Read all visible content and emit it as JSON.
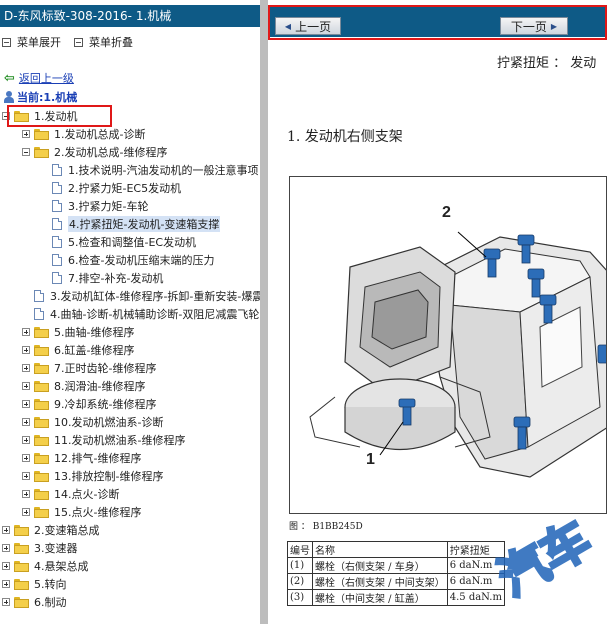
{
  "sidebar": {
    "title": "D-东风标致-308-2016- 1.机械",
    "menu_expand": "菜单展开",
    "menu_collapse": "菜单折叠",
    "back": "返回上一级",
    "current": "当前:1.机械",
    "tree": [
      {
        "label": "1.发动机",
        "level": 0,
        "type": "folder",
        "toggle": "minus"
      },
      {
        "label": "1.发动机总成-诊断",
        "level": 1,
        "type": "folder",
        "toggle": "plus"
      },
      {
        "label": "2.发动机总成-维修程序",
        "level": 1,
        "type": "folder",
        "toggle": "minus"
      },
      {
        "label": "1.技术说明-汽油发动机的一般注意事项",
        "level": 2,
        "type": "page"
      },
      {
        "label": "2.拧紧力矩-EC5发动机",
        "level": 2,
        "type": "page"
      },
      {
        "label": "3.拧紧力矩-车轮",
        "level": 2,
        "type": "page"
      },
      {
        "label": "4.拧紧扭矩-发动机-变速箱支撑",
        "level": 2,
        "type": "page",
        "selected": true
      },
      {
        "label": "5.检查和调整值-EC发动机",
        "level": 2,
        "type": "page"
      },
      {
        "label": "6.检查-发动机压缩末端的压力",
        "level": 2,
        "type": "page"
      },
      {
        "label": "7.排空-补充-发动机",
        "level": 2,
        "type": "page"
      },
      {
        "label": "3.发动机缸体-维修程序-拆卸-重新安装-爆震",
        "level": 1,
        "type": "page"
      },
      {
        "label": "4.曲轴-诊断-机械辅助诊断-双阻尼减震飞轮",
        "level": 1,
        "type": "page"
      },
      {
        "label": "5.曲轴-维修程序",
        "level": 1,
        "type": "folder",
        "toggle": "plus"
      },
      {
        "label": "6.缸盖-维修程序",
        "level": 1,
        "type": "folder",
        "toggle": "plus"
      },
      {
        "label": "7.正时齿轮-维修程序",
        "level": 1,
        "type": "folder",
        "toggle": "plus"
      },
      {
        "label": "8.润滑油-维修程序",
        "level": 1,
        "type": "folder",
        "toggle": "plus"
      },
      {
        "label": "9.冷却系统-维修程序",
        "level": 1,
        "type": "folder",
        "toggle": "plus"
      },
      {
        "label": "10.发动机燃油系-诊断",
        "level": 1,
        "type": "folder",
        "toggle": "plus"
      },
      {
        "label": "11.发动机燃油系-维修程序",
        "level": 1,
        "type": "folder",
        "toggle": "plus"
      },
      {
        "label": "12.排气-维修程序",
        "level": 1,
        "type": "folder",
        "toggle": "plus"
      },
      {
        "label": "13.排放控制-维修程序",
        "level": 1,
        "type": "folder",
        "toggle": "plus"
      },
      {
        "label": "14.点火-诊断",
        "level": 1,
        "type": "folder",
        "toggle": "plus"
      },
      {
        "label": "15.点火-维修程序",
        "level": 1,
        "type": "folder",
        "toggle": "plus"
      },
      {
        "label": "2.变速箱总成",
        "level": 0,
        "type": "folder",
        "toggle": "plus"
      },
      {
        "label": "3.变速器",
        "level": 0,
        "type": "folder",
        "toggle": "plus"
      },
      {
        "label": "4.悬架总成",
        "level": 0,
        "type": "folder",
        "toggle": "plus"
      },
      {
        "label": "5.转向",
        "level": 0,
        "type": "folder",
        "toggle": "plus"
      },
      {
        "label": "6.制动",
        "level": 0,
        "type": "folder",
        "toggle": "plus"
      }
    ]
  },
  "nav": {
    "prev": "上一页",
    "next": "下一页"
  },
  "content": {
    "torque_heading": "拧紧扭矩 ： 发动",
    "section_title": "1. 发动机右侧支架",
    "callout_1": "1",
    "callout_2": "2",
    "figure_caption": "图 ： B1BB245D",
    "table": {
      "headers": [
        "编号",
        "名称",
        "拧紧扭矩"
      ],
      "rows": [
        [
          "(1)",
          "螺栓（右侧支架 / 车身）",
          "6 daN.m"
        ],
        [
          "(2)",
          "螺栓（右侧支架 / 中间支架）",
          "6 daN.m"
        ],
        [
          "(3)",
          "螺栓（中间支架 / 缸盖）",
          "4.5 daN.m"
        ]
      ]
    },
    "watermark": "汽车"
  }
}
